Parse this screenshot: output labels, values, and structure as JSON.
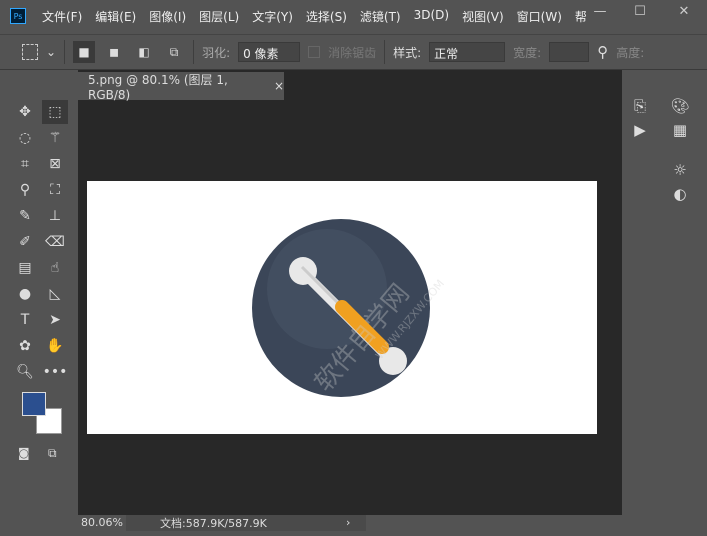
{
  "app": {
    "logo": "Ps"
  },
  "menu": [
    "文件(F)",
    "编辑(E)",
    "图像(I)",
    "图层(L)",
    "文字(Y)",
    "选择(S)",
    "滤镜(T)",
    "3D(D)",
    "视图(V)",
    "窗口(W)",
    "帮"
  ],
  "window": {
    "minimize": "—",
    "maximize": "☐",
    "close": "✕"
  },
  "options": {
    "feather_label": "羽化:",
    "feather_value": "0 像素",
    "antialias_label": "消除锯齿",
    "style_label": "样式:",
    "style_value": "正常",
    "width_label": "宽度:",
    "height_label": "高度:"
  },
  "document": {
    "tab_title": "5.png @ 80.1% (图层 1, RGB/8)",
    "close": "×",
    "watermark": "软件自学网",
    "watermark_url": "WWW.RJZXW.COM"
  },
  "status": {
    "zoom": "80.06%",
    "doc_size": "文档:587.9K/587.9K",
    "arrow": "›"
  },
  "colors": {
    "foreground": "#2b4f8f",
    "background": "#ffffff",
    "circle": "#3b4658",
    "handle": "#f0a020"
  },
  "tools": [
    "move",
    "rect-marquee",
    "lasso",
    "magic-wand",
    "crop",
    "frame",
    "eyedropper",
    "patch",
    "brush",
    "stamp",
    "history-brush",
    "eraser",
    "gradient",
    "smudge",
    "dodge",
    "path-select",
    "type",
    "direct-select",
    "pen-custom",
    "hand",
    "zoom",
    "more"
  ]
}
